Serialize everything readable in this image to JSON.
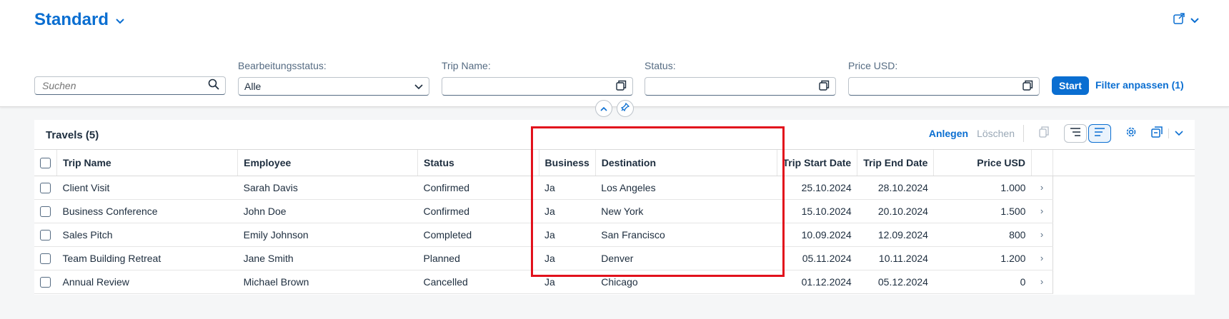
{
  "variant": {
    "title": "Standard"
  },
  "filters": {
    "search_placeholder": "Suchen",
    "items": [
      {
        "label": "Bearbeitungsstatus:",
        "value": "Alle"
      },
      {
        "label": "Trip Name:",
        "value": ""
      },
      {
        "label": "Status:",
        "value": ""
      },
      {
        "label": "Price USD:",
        "value": ""
      }
    ],
    "start_label": "Start",
    "adapt_label": "Filter anpassen (1)"
  },
  "table": {
    "title": "Travels (5)",
    "create_label": "Anlegen",
    "delete_label": "Löschen",
    "columns": [
      "Trip Name",
      "Employee",
      "Status",
      "Business",
      "Destination",
      "Trip Start Date",
      "Trip End Date",
      "Price USD"
    ],
    "rows": [
      [
        "Client Visit",
        "Sarah Davis",
        "Confirmed",
        "Ja",
        "Los Angeles",
        "25.10.2024",
        "28.10.2024",
        "1.000"
      ],
      [
        "Business Conference",
        "John Doe",
        "Confirmed",
        "Ja",
        "New York",
        "15.10.2024",
        "20.10.2024",
        "1.500"
      ],
      [
        "Sales Pitch",
        "Emily Johnson",
        "Completed",
        "Ja",
        "San Francisco",
        "10.09.2024",
        "12.09.2024",
        "800"
      ],
      [
        "Team Building Retreat",
        "Jane Smith",
        "Planned",
        "Ja",
        "Denver",
        "05.11.2024",
        "10.11.2024",
        "1.200"
      ],
      [
        "Annual Review",
        "Michael Brown",
        "Cancelled",
        "Ja",
        "Chicago",
        "01.12.2024",
        "05.12.2024",
        "0"
      ]
    ]
  },
  "colors": {
    "accent": "#0a6ed1",
    "highlight": "#e2111c"
  }
}
